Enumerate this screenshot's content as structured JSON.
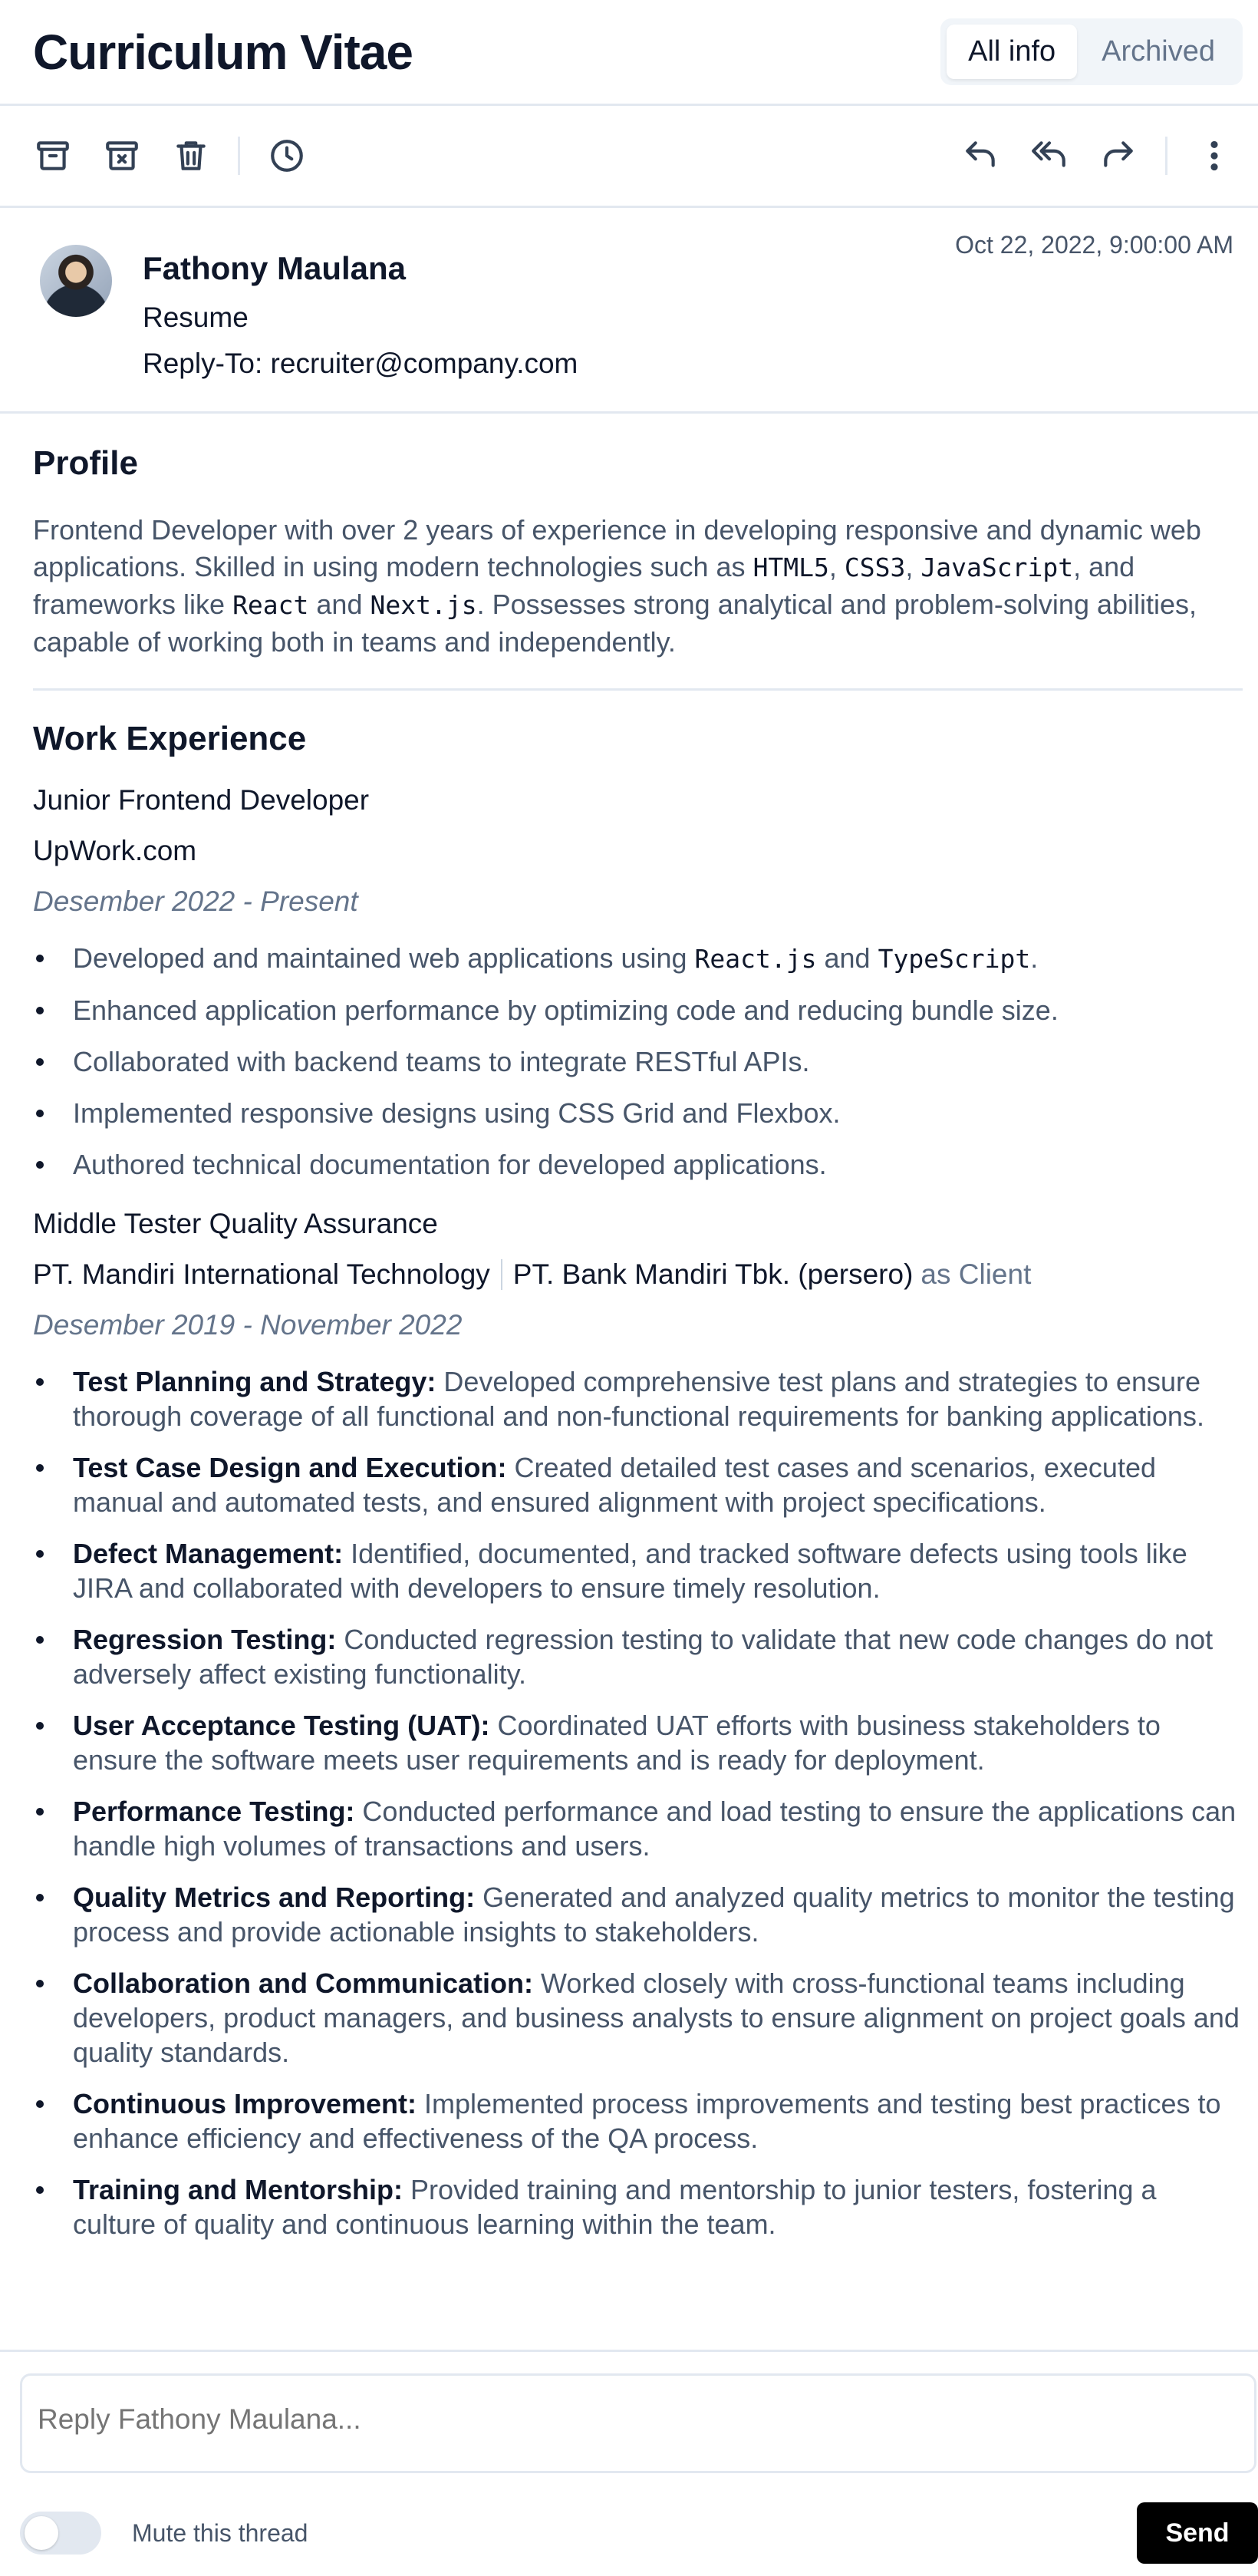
{
  "page": {
    "title": "Curriculum Vitae",
    "tabs": [
      {
        "label": "All info",
        "active": true
      },
      {
        "label": "Archived",
        "active": false
      }
    ]
  },
  "toolbar": {
    "left_icons": [
      "archive-icon",
      "archive-x-icon",
      "trash-icon",
      "clock-icon"
    ],
    "right_icons": [
      "reply-icon",
      "reply-all-icon",
      "forward-icon",
      "more-vertical-icon"
    ]
  },
  "email": {
    "sender": "Fathony Maulana",
    "subject": "Resume",
    "reply_to": "Reply-To: recruiter@company.com",
    "date": "Oct 22, 2022, 9:00:00 AM"
  },
  "profile": {
    "heading": "Profile",
    "parts": [
      {
        "t": "Frontend Developer with over 2 years of experience in developing responsive and dynamic web applications. Skilled in using modern technologies such as "
      },
      {
        "c": "HTML5"
      },
      {
        "t": ", "
      },
      {
        "c": "CSS3"
      },
      {
        "t": ", "
      },
      {
        "c": "JavaScript"
      },
      {
        "t": ", and frameworks like "
      },
      {
        "c": "React"
      },
      {
        "t": " and "
      },
      {
        "c": "Next.js"
      },
      {
        "t": ". Possesses strong analytical and problem-solving abilities, capable of working both in teams and independently."
      }
    ]
  },
  "work": {
    "heading": "Work Experience",
    "jobs": [
      {
        "title": "Junior Frontend Developer",
        "company": "UpWork.com",
        "period": "Desember 2022 - Present",
        "bullets": [
          [
            {
              "t": "Developed and maintained web applications using "
            },
            {
              "c": "React.js"
            },
            {
              "t": " and "
            },
            {
              "c": "TypeScript"
            },
            {
              "t": "."
            }
          ],
          [
            {
              "t": "Enhanced application performance by optimizing code and reducing bundle size."
            }
          ],
          [
            {
              "t": "Collaborated with backend teams to integrate RESTful APIs."
            }
          ],
          [
            {
              "t": "Implemented responsive designs using CSS Grid and Flexbox."
            }
          ],
          [
            {
              "t": "Authored technical documentation for developed applications."
            }
          ]
        ]
      },
      {
        "title": "Middle Tester Quality Assurance",
        "company": "PT. Mandiri International Technology",
        "client": "PT. Bank Mandiri Tbk. (persero)",
        "client_label": "as Client",
        "period": "Desember 2019 - November 2022",
        "bullets": [
          [
            {
              "b": "Test Planning and Strategy:"
            },
            {
              "t": " Developed comprehensive test plans and strategies to ensure thorough coverage of all functional and non-functional requirements for banking applications."
            }
          ],
          [
            {
              "b": "Test Case Design and Execution:"
            },
            {
              "t": " Created detailed test cases and scenarios, executed manual and automated tests, and ensured alignment with project specifications."
            }
          ],
          [
            {
              "b": "Defect Management:"
            },
            {
              "t": " Identified, documented, and tracked software defects using tools like JIRA and collaborated with developers to ensure timely resolution."
            }
          ],
          [
            {
              "b": "Regression Testing:"
            },
            {
              "t": " Conducted regression testing to validate that new code changes do not adversely affect existing functionality."
            }
          ],
          [
            {
              "b": "User Acceptance Testing (UAT):"
            },
            {
              "t": " Coordinated UAT efforts with business stakeholders to ensure the software meets user requirements and is ready for deployment."
            }
          ],
          [
            {
              "b": "Performance Testing:"
            },
            {
              "t": " Conducted performance and load testing to ensure the applications can handle high volumes of transactions and users."
            }
          ],
          [
            {
              "b": "Quality Metrics and Reporting:"
            },
            {
              "t": " Generated and analyzed quality metrics to monitor the testing process and provide actionable insights to stakeholders."
            }
          ],
          [
            {
              "b": "Collaboration and Communication:"
            },
            {
              "t": " Worked closely with cross-functional teams including developers, product managers, and business analysts to ensure alignment on project goals and quality standards."
            }
          ],
          [
            {
              "b": "Continuous Improvement:"
            },
            {
              "t": " Implemented process improvements and testing best practices to enhance efficiency and effectiveness of the QA process."
            }
          ],
          [
            {
              "b": "Training and Mentorship:"
            },
            {
              "t": " Provided training and mentorship to junior testers, fostering a culture of quality and continuous learning within the team."
            }
          ]
        ]
      }
    ]
  },
  "reply": {
    "placeholder": "Reply Fathony Maulana...",
    "mute_label": "Mute this thread",
    "mute_on": false,
    "send_label": "Send"
  }
}
